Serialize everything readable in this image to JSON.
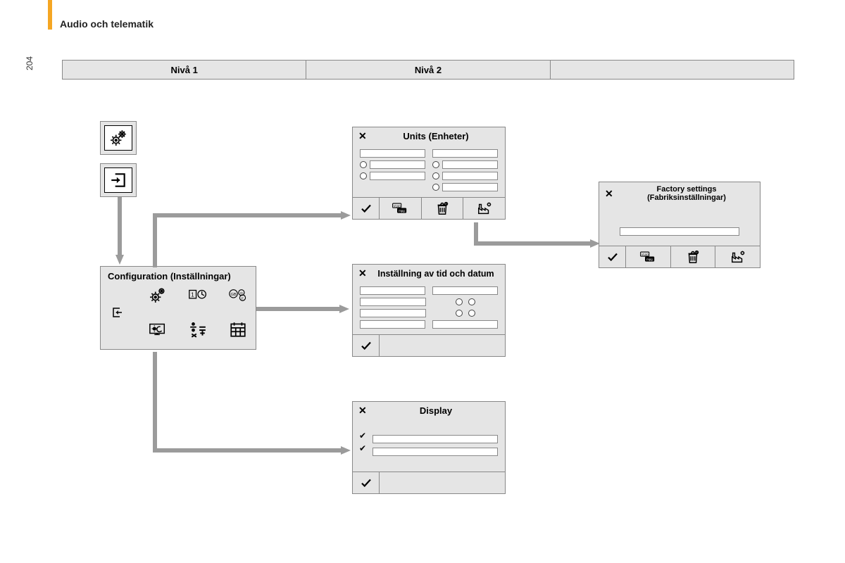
{
  "header": {
    "title": "Audio och telematik",
    "page_number": "204"
  },
  "levels": [
    "Nivå 1",
    "Nivå 2",
    ""
  ],
  "panels": {
    "config": {
      "title": "Configuration (Inställningar)"
    },
    "units": {
      "title": "Units (Enheter)"
    },
    "datetime": {
      "title": "Inställning av tid och datum"
    },
    "display": {
      "title": "Display"
    },
    "factory": {
      "title": "Factory settings (Fabriksinställningar)"
    }
  },
  "icons": {
    "gears": "gears-icon",
    "enter": "enter-icon",
    "back": "back-icon",
    "clock": "clock-date-icon",
    "lang": "language-icon",
    "screen": "display-night-icon",
    "math": "units-math-icon",
    "calendar": "calendar-icon",
    "check": "confirm-check-icon",
    "mpg": "mpg-km-icon",
    "trash": "trash-icon",
    "factory": "factory-icon"
  }
}
